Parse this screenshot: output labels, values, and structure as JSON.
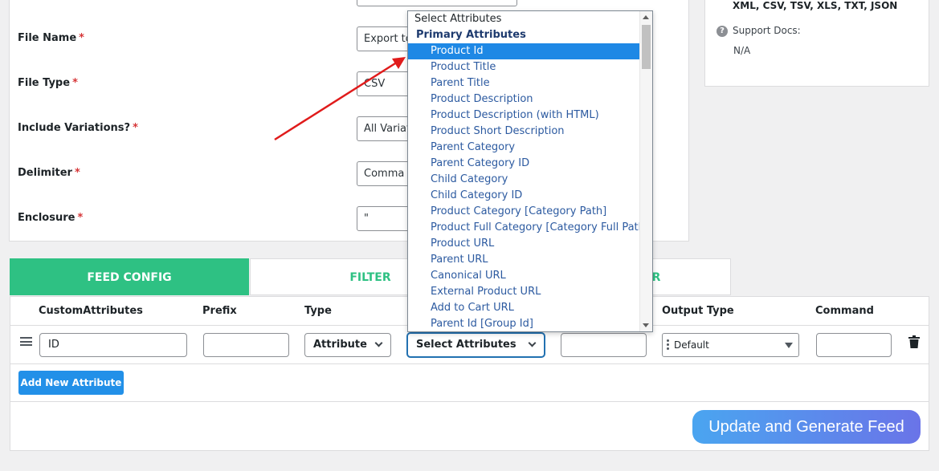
{
  "colors": {
    "accent_green": "#2ec183",
    "primary_blue": "#2290e8",
    "required_red": "#d63638",
    "highlight_blue": "#1e88e5",
    "annotation_red": "#e01b1b"
  },
  "settings": {
    "fields": [
      {
        "label": "File Name",
        "required": "*",
        "value": "Export to"
      },
      {
        "label": "File Type",
        "required": "*",
        "value": "CSV"
      },
      {
        "label": "Include Variations?",
        "required": "*",
        "value": "All Variat"
      },
      {
        "label": "Delimiter",
        "required": "*",
        "value": "Comma"
      },
      {
        "label": "Enclosure",
        "required": "*",
        "value": "\""
      }
    ]
  },
  "info_panel": {
    "formats": "XML, CSV, TSV, XLS, TXT, JSON",
    "docs_label": "Support Docs:",
    "docs_value": "N/A",
    "docs_icon": "question-icon"
  },
  "tabs": [
    {
      "label": "FEED CONFIG",
      "active": true
    },
    {
      "label": "FILTER",
      "active": false
    },
    {
      "label": "ER",
      "active": false
    }
  ],
  "table": {
    "headers": [
      "CustomAttributes",
      "Prefix",
      "Type",
      "Output Type",
      "Command"
    ],
    "row": {
      "custom_attribute": "ID",
      "prefix": "",
      "type": "Attribute",
      "attribute": "Select Attributes",
      "suffix": "",
      "output_type": "Default",
      "command": ""
    },
    "add_button": "Add New Attribute",
    "generate_button": "Update and Generate Feed"
  },
  "dropdown": {
    "placeholder": "Select Attributes",
    "group": "Primary Attributes",
    "selected": "Product Id",
    "options": [
      "Product Id",
      "Product Title",
      "Parent Title",
      "Product Description",
      "Product Description (with HTML)",
      "Product Short Description",
      "Parent Category",
      "Parent Category ID",
      "Child Category",
      "Child Category ID",
      "Product Category [Category Path]",
      "Product Full Category [Category Full Path]",
      "Product URL",
      "Parent URL",
      "Canonical URL",
      "External Product URL",
      "Add to Cart URL",
      "Parent Id [Group Id]"
    ]
  }
}
